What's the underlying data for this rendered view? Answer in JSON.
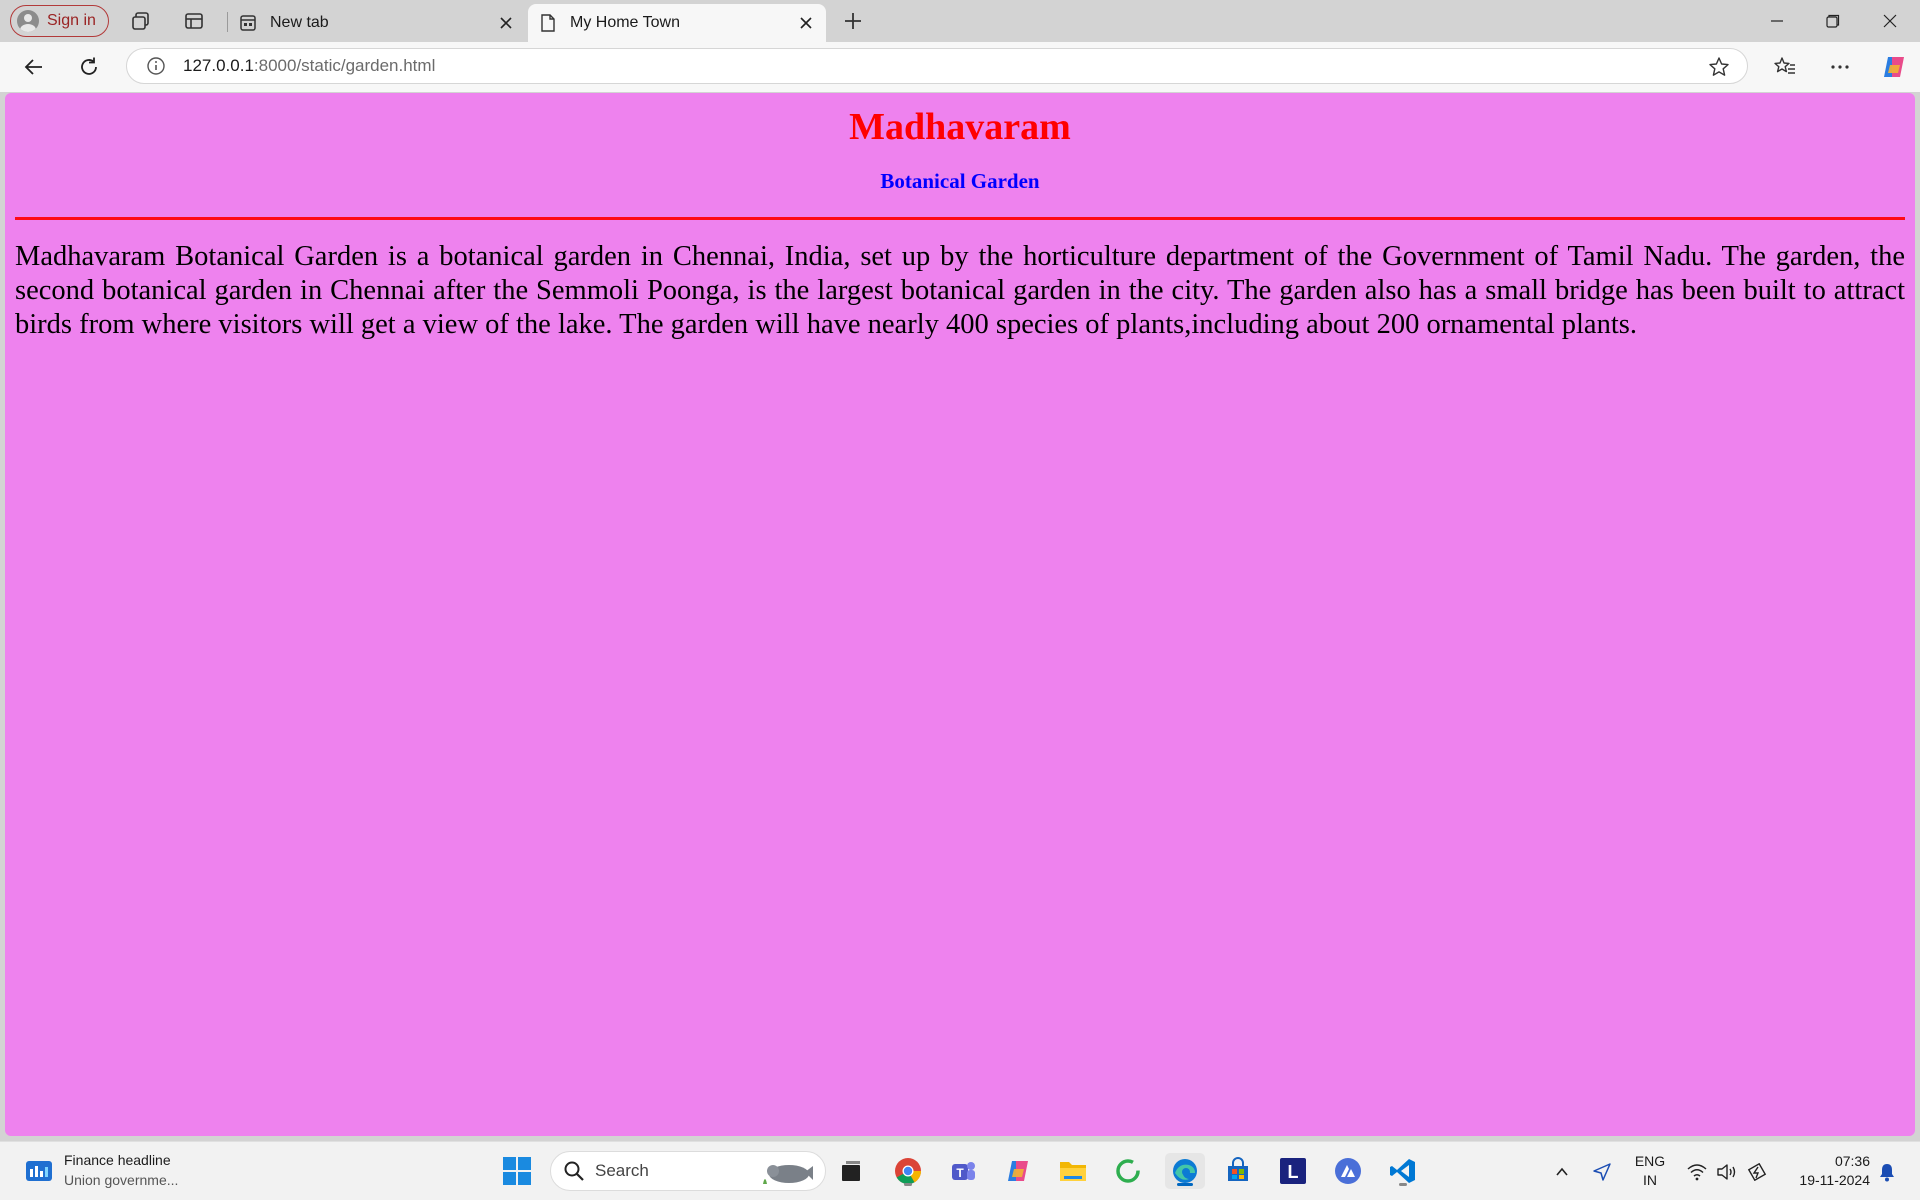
{
  "browser": {
    "sign_in_label": "Sign in",
    "tabs": [
      {
        "title": "New tab",
        "active": false
      },
      {
        "title": "My Home Town",
        "active": true
      }
    ],
    "address": {
      "host": "127.0.0.1",
      "path": ":8000/static/garden.html"
    }
  },
  "page": {
    "heading": "Madhavaram",
    "subheading": "Botanical Garden",
    "paragraph": "Madhavaram Botanical Garden is a botanical garden in Chennai, India, set up by the horticulture department of the Government of Tamil Nadu. The garden, the second botanical garden in Chennai after the Semmoli Poonga, is the largest botanical garden in the city. The garden also has a small bridge has been built to attract birds from where visitors will get a view of the lake. The garden will have nearly 400 species of plants,including about 200 ornamental plants."
  },
  "colors": {
    "page_background": "#ee82ee",
    "heading": "#ff0000",
    "subheading": "#0000ff",
    "rule": "#ff0000"
  },
  "taskbar": {
    "widget": {
      "title": "Finance headline",
      "subtitle": "Union governme..."
    },
    "search_label": "Search",
    "apps": [
      "task-view-icon",
      "chrome-icon",
      "teams-icon",
      "copilot-icon",
      "file-explorer-icon",
      "refresh-app-icon",
      "edge-icon",
      "store-icon",
      "l-app-icon",
      "tri-app-icon",
      "vscode-icon"
    ],
    "language": {
      "line1": "ENG",
      "line2": "IN"
    },
    "clock": {
      "time": "07:36",
      "date": "19-11-2024"
    }
  }
}
